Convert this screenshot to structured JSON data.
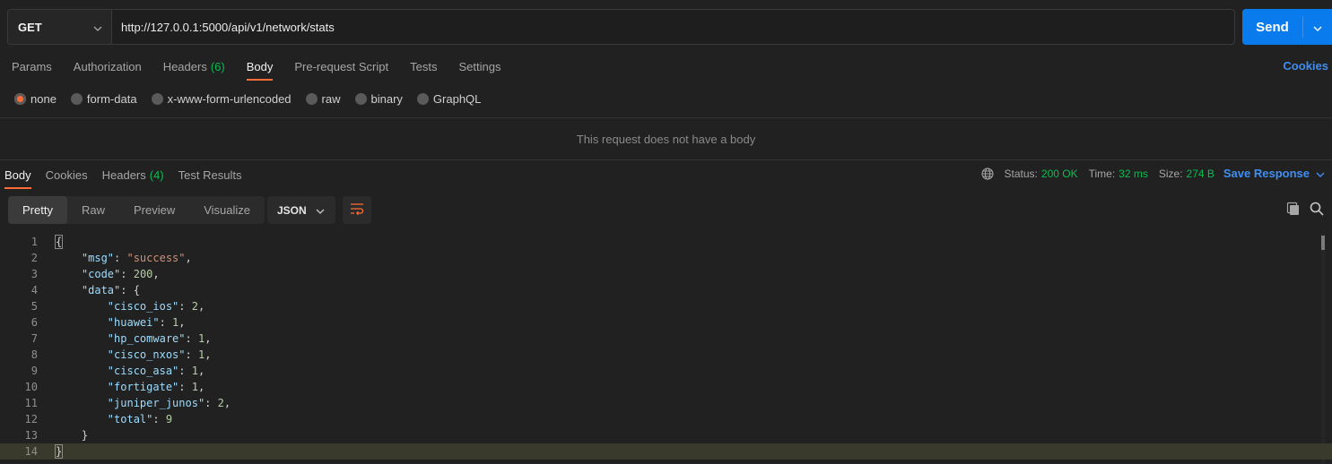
{
  "request": {
    "method": "GET",
    "url": "http://127.0.0.1:5000/api/v1/network/stats",
    "send_label": "Send"
  },
  "request_tabs": [
    {
      "label": "Params",
      "count": ""
    },
    {
      "label": "Authorization",
      "count": ""
    },
    {
      "label": "Headers",
      "count": "(6)"
    },
    {
      "label": "Body",
      "count": "",
      "active": true
    },
    {
      "label": "Pre-request Script",
      "count": ""
    },
    {
      "label": "Tests",
      "count": ""
    },
    {
      "label": "Settings",
      "count": ""
    }
  ],
  "cookies_link": "Cookies",
  "body_types": [
    {
      "label": "none",
      "checked": true
    },
    {
      "label": "form-data"
    },
    {
      "label": "x-www-form-urlencoded"
    },
    {
      "label": "raw"
    },
    {
      "label": "binary"
    },
    {
      "label": "GraphQL"
    }
  ],
  "no_body_message": "This request does not have a body",
  "response_tabs": [
    {
      "label": "Body",
      "count": "",
      "active": true
    },
    {
      "label": "Cookies",
      "count": ""
    },
    {
      "label": "Headers",
      "count": "(4)"
    },
    {
      "label": "Test Results",
      "count": ""
    }
  ],
  "response_status": {
    "status_label": "Status:",
    "status_value": "200 OK",
    "time_label": "Time:",
    "time_value": "32 ms",
    "size_label": "Size:",
    "size_value": "274 B",
    "save_label": "Save Response"
  },
  "view_modes": [
    {
      "label": "Pretty",
      "active": true
    },
    {
      "label": "Raw"
    },
    {
      "label": "Preview"
    },
    {
      "label": "Visualize"
    }
  ],
  "format": "JSON",
  "colors": {
    "accent": "#ff6c37",
    "send": "#097bed",
    "success": "#0cbb52",
    "link": "#3f8ef0"
  },
  "code_lines": [
    {
      "n": "1",
      "t": [
        [
          "p",
          "{"
        ]
      ]
    },
    {
      "n": "2",
      "t": [
        [
          "p",
          "    "
        ],
        [
          "k",
          "\"msg\""
        ],
        [
          "p",
          ": "
        ],
        [
          "s",
          "\"success\""
        ],
        [
          "p",
          ","
        ]
      ]
    },
    {
      "n": "3",
      "t": [
        [
          "p",
          "    "
        ],
        [
          "k",
          "\"code\""
        ],
        [
          "p",
          ": "
        ],
        [
          "n",
          "200"
        ],
        [
          "p",
          ","
        ]
      ]
    },
    {
      "n": "4",
      "t": [
        [
          "p",
          "    "
        ],
        [
          "k",
          "\"data\""
        ],
        [
          "p",
          ": {"
        ]
      ]
    },
    {
      "n": "5",
      "t": [
        [
          "p",
          "        "
        ],
        [
          "k",
          "\"cisco_ios\""
        ],
        [
          "p",
          ": "
        ],
        [
          "n",
          "2"
        ],
        [
          "p",
          ","
        ]
      ]
    },
    {
      "n": "6",
      "t": [
        [
          "p",
          "        "
        ],
        [
          "k",
          "\"huawei\""
        ],
        [
          "p",
          ": "
        ],
        [
          "n",
          "1"
        ],
        [
          "p",
          ","
        ]
      ]
    },
    {
      "n": "7",
      "t": [
        [
          "p",
          "        "
        ],
        [
          "k",
          "\"hp_comware\""
        ],
        [
          "p",
          ": "
        ],
        [
          "n",
          "1"
        ],
        [
          "p",
          ","
        ]
      ]
    },
    {
      "n": "8",
      "t": [
        [
          "p",
          "        "
        ],
        [
          "k",
          "\"cisco_nxos\""
        ],
        [
          "p",
          ": "
        ],
        [
          "n",
          "1"
        ],
        [
          "p",
          ","
        ]
      ]
    },
    {
      "n": "9",
      "t": [
        [
          "p",
          "        "
        ],
        [
          "k",
          "\"cisco_asa\""
        ],
        [
          "p",
          ": "
        ],
        [
          "n",
          "1"
        ],
        [
          "p",
          ","
        ]
      ]
    },
    {
      "n": "10",
      "t": [
        [
          "p",
          "        "
        ],
        [
          "k",
          "\"fortigate\""
        ],
        [
          "p",
          ": "
        ],
        [
          "n",
          "1"
        ],
        [
          "p",
          ","
        ]
      ]
    },
    {
      "n": "11",
      "t": [
        [
          "p",
          "        "
        ],
        [
          "k",
          "\"juniper_junos\""
        ],
        [
          "p",
          ": "
        ],
        [
          "n",
          "2"
        ],
        [
          "p",
          ","
        ]
      ]
    },
    {
      "n": "12",
      "t": [
        [
          "p",
          "        "
        ],
        [
          "k",
          "\"total\""
        ],
        [
          "p",
          ": "
        ],
        [
          "n",
          "9"
        ]
      ]
    },
    {
      "n": "13",
      "t": [
        [
          "p",
          "    }"
        ]
      ]
    },
    {
      "n": "14",
      "t": [
        [
          "p",
          "}"
        ]
      ],
      "current": true
    }
  ]
}
